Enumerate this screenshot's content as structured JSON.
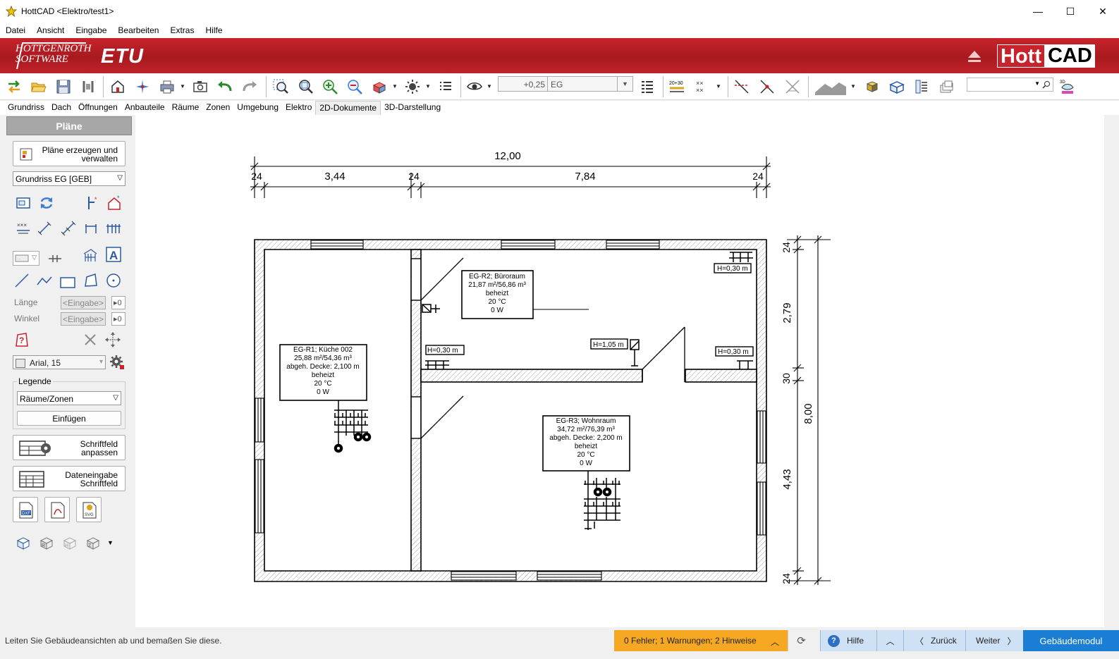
{
  "window": {
    "title": "HottCAD <Elektro/test1>",
    "minimize": "—",
    "maximize": "☐",
    "close": "✕"
  },
  "menu": [
    "Datei",
    "Ansicht",
    "Eingabe",
    "Bearbeiten",
    "Extras",
    "Hilfe"
  ],
  "banner": {
    "company_line1": "HOTTGENROTH",
    "company_line2": "SOFTWARE",
    "product": "ETU",
    "brand_left": "Hott",
    "brand_right": "CAD"
  },
  "toolbar": {
    "offset_value": "+0,25",
    "level_select": "EG",
    "search_value": "",
    "icons": [
      "import-export-icon",
      "open-folder-icon",
      "save-icon",
      "tools-icon",
      "building-icon",
      "sparkle-icon",
      "print-icon",
      "camera-icon",
      "undo-icon",
      "redo-icon",
      "zoom-window-icon",
      "zoom-all-icon",
      "zoom-in-icon",
      "zoom-out-icon",
      "view-3d-icon",
      "light-icon",
      "list-icon",
      "eye-icon",
      "layers-icon",
      "dimension-icon",
      "grid-icon",
      "snap-line-icon",
      "snap-point-icon",
      "snap-cross-icon",
      "terrain-icon",
      "cube-yellow-icon",
      "cube-blue-icon",
      "floors-icon",
      "stack-icon",
      "3d-eye-icon"
    ]
  },
  "tabs": [
    {
      "label": "Grundriss",
      "active": false
    },
    {
      "label": "Dach",
      "active": false
    },
    {
      "label": "Öffnungen",
      "active": false
    },
    {
      "label": "Anbauteile",
      "active": false
    },
    {
      "label": "Räume",
      "active": false
    },
    {
      "label": "Zonen",
      "active": false
    },
    {
      "label": "Umgebung",
      "active": false
    },
    {
      "label": "Elektro",
      "active": false
    },
    {
      "label": "2D-Dokumente",
      "active": true
    },
    {
      "label": "3D-Darstellung",
      "active": false
    }
  ],
  "panel": {
    "title": "Pläne",
    "plans_button": "Pläne erzeugen und verwalten",
    "plan_select": "Grundriss EG [GEB]",
    "length_label": "Länge",
    "angle_label": "Winkel",
    "input_placeholder": "<Eingabe>",
    "spin_value": "0",
    "font_select": "Arial, 15",
    "legend_title": "Legende",
    "legend_select": "Räume/Zonen",
    "insert_button": "Einfügen",
    "titleblock_button": "Schriftfeld anpassen",
    "dataentry_button": "Dateneingabe Schriftfeld"
  },
  "drawing": {
    "dim_top_total": "12,00",
    "dim_top_parts": [
      "24",
      "3,44",
      "24",
      "7,84",
      "24"
    ],
    "dim_right_parts": [
      "24",
      "2,79",
      "30",
      "4,43",
      "24"
    ],
    "dim_right_total": "8,00",
    "rooms": [
      {
        "lines": [
          "EG-R1; Küche 002",
          "25,88 m²/54,36 m³",
          "abgeh. Decke: 2,100 m",
          "beheizt",
          "20 °C",
          "0 W"
        ]
      },
      {
        "lines": [
          "EG-R2; Büroraum",
          "21,87 m²/56,86 m³",
          "beheizt",
          "20 °C",
          "0 W"
        ]
      },
      {
        "lines": [
          "EG-R3; Wohnraum",
          "34,72 m²/76,39 m³",
          "abgeh. Decke: 2,200 m",
          "beheizt",
          "20 °C",
          "0 W"
        ]
      }
    ],
    "heights": [
      "H=0,30 m",
      "H=0,30 m",
      "H=0,30 m",
      "H=1,05 m"
    ]
  },
  "status": {
    "hint": "Leiten Sie Gebäudeansichten ab und bemaßen Sie diese.",
    "warnings": "0 Fehler; 1 Warnungen; 2 Hinweise",
    "help": "Hilfe",
    "back": "Zurück",
    "next": "Weiter",
    "module": "Gebäudemodul"
  }
}
